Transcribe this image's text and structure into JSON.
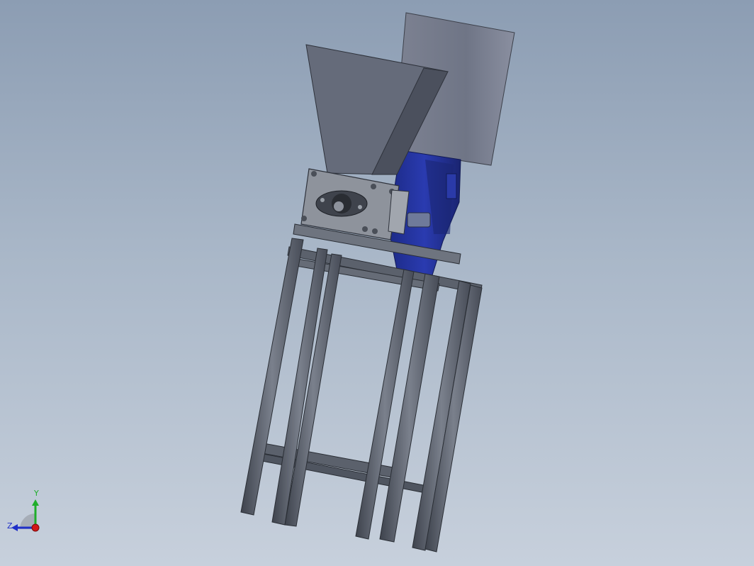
{
  "viewport": {
    "background_top": "#8c9db3",
    "background_bottom": "#c7d0dc"
  },
  "model": {
    "parts": [
      "hopper",
      "cylinder-housing",
      "motor-gearbox",
      "bearing-plate",
      "flange-bearing",
      "aluminum-profile-frame"
    ],
    "colors": {
      "hopper": "#656b7a",
      "cylinder": "#767c8d",
      "motor": "#24349a",
      "frame": "#5a606c",
      "plate": "#8e939c"
    }
  },
  "triad": {
    "y_label": "Y",
    "z_label": "Z",
    "y_color": "#1fae2a",
    "z_color": "#1f2fc8",
    "x_color": "#d21818"
  }
}
